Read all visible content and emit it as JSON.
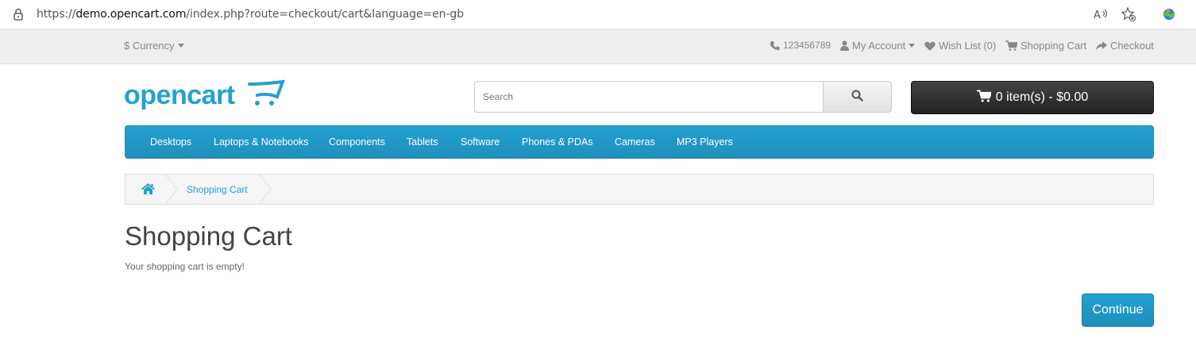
{
  "browser": {
    "url_prefix": "https://",
    "url_host": "demo.opencart.com",
    "url_path": "/index.php?route=checkout/cart&language=en-gb"
  },
  "topbar": {
    "currency_label": "$ Currency",
    "phone": "123456789",
    "my_account": "My Account",
    "wish_list": "Wish List (0)",
    "shopping_cart": "Shopping Cart",
    "checkout": "Checkout"
  },
  "header": {
    "logo_text": "opencart",
    "search_placeholder": "Search",
    "cart_button": "0 item(s) - $0.00"
  },
  "menu": {
    "items": [
      "Desktops",
      "Laptops & Notebooks",
      "Components",
      "Tablets",
      "Software",
      "Phones & PDAs",
      "Cameras",
      "MP3 Players"
    ]
  },
  "breadcrumb": {
    "current": "Shopping Cart"
  },
  "content": {
    "title": "Shopping Cart",
    "message": "Your shopping cart is empty!",
    "continue_button": "Continue"
  },
  "colors": {
    "accent": "#23a1d1",
    "topbar_bg": "#eeeeee",
    "cart_button_bg": "#222222"
  },
  "icons": [
    "lock-icon",
    "read-aloud-icon",
    "favorites-icon",
    "extension-icon",
    "phone-icon",
    "user-icon",
    "heart-icon",
    "cart-icon",
    "share-icon",
    "search-icon",
    "home-icon"
  ]
}
